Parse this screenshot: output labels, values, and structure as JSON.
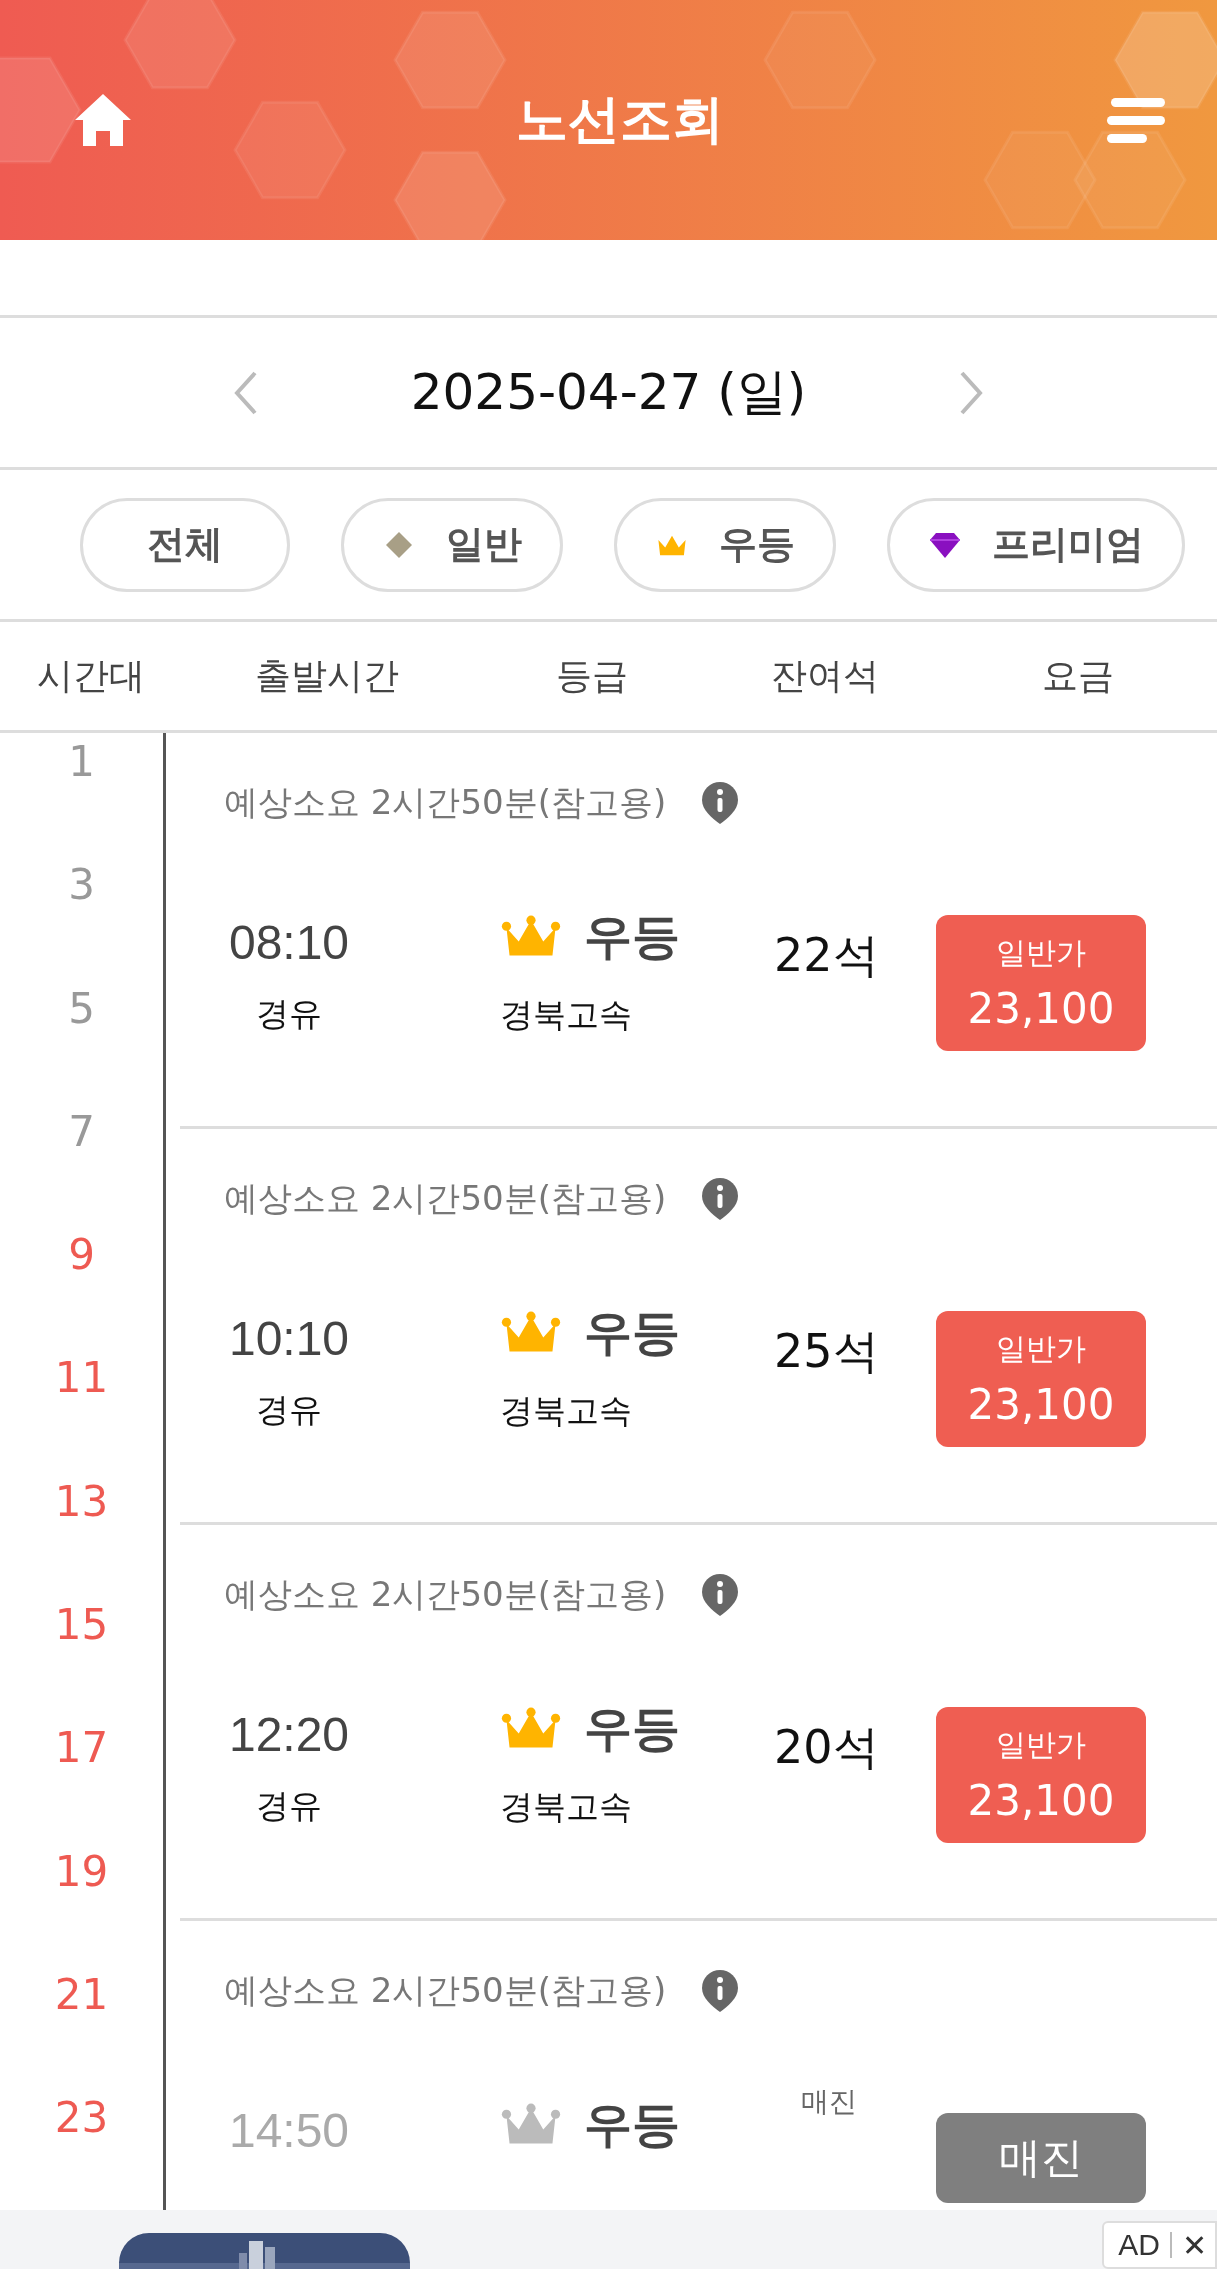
{
  "header": {
    "title": "노선조회"
  },
  "date_nav": {
    "date": "2025-04-27 (일)"
  },
  "filters": [
    {
      "label": "전체",
      "kind": "all"
    },
    {
      "label": "일반",
      "kind": "standard"
    },
    {
      "label": "우등",
      "kind": "deluxe"
    },
    {
      "label": "프리미엄",
      "kind": "premium"
    }
  ],
  "columns": [
    "시간대",
    "출발시간",
    "등급",
    "잔여석",
    "요금"
  ],
  "hours": [
    {
      "label": "1",
      "active": false
    },
    {
      "label": "3",
      "active": false
    },
    {
      "label": "5",
      "active": false
    },
    {
      "label": "7",
      "active": false
    },
    {
      "label": "9",
      "active": true
    },
    {
      "label": "11",
      "active": true
    },
    {
      "label": "13",
      "active": true
    },
    {
      "label": "15",
      "active": true
    },
    {
      "label": "17",
      "active": true
    },
    {
      "label": "19",
      "active": true
    },
    {
      "label": "21",
      "active": true
    },
    {
      "label": "23",
      "active": true
    }
  ],
  "departures": [
    {
      "duration": "예상소요 2시간50분(참고용)",
      "time": "08:10",
      "via": "경유",
      "grade": "우등",
      "company": "경북고속",
      "seats": "22석",
      "price_label": "일반가",
      "price": "23,100",
      "sold_out": false
    },
    {
      "duration": "예상소요 2시간50분(참고용)",
      "time": "10:10",
      "via": "경유",
      "grade": "우등",
      "company": "경북고속",
      "seats": "25석",
      "price_label": "일반가",
      "price": "23,100",
      "sold_out": false
    },
    {
      "duration": "예상소요 2시간50분(참고용)",
      "time": "12:20",
      "via": "경유",
      "grade": "우등",
      "company": "경북고속",
      "seats": "20석",
      "price_label": "일반가",
      "price": "23,100",
      "sold_out": false
    },
    {
      "duration": "예상소요 2시간50분(참고용)",
      "time": "14:50",
      "grade": "우등",
      "seats": "매진",
      "price": "매진",
      "sold_out": true
    }
  ],
  "ad": {
    "badge": "AD",
    "close": "✕"
  }
}
